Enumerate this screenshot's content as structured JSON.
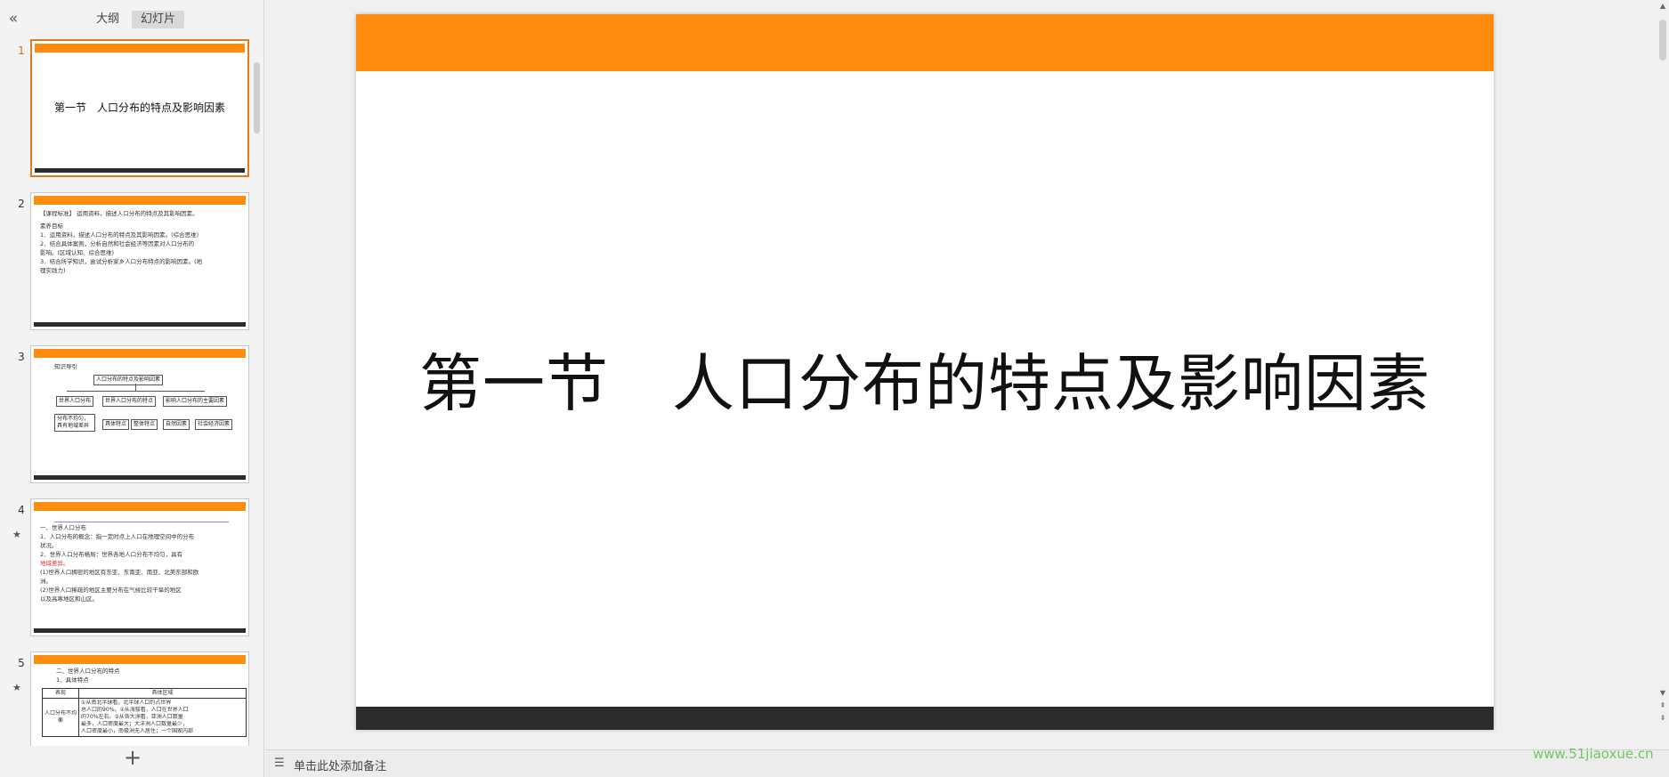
{
  "sidebar": {
    "collapse_icon": "«",
    "tabs": [
      "大纲",
      "幻灯片"
    ],
    "active_tab": "幻灯片",
    "add_icon": "+",
    "slides": [
      {
        "number": "1",
        "title": "第一节　人口分布的特点及影响因素"
      },
      {
        "number": "2",
        "lines": [
          "【课程标准】 运用资料，描述人口分布的特点及其影响因素。",
          "素养目标",
          "1．运用资料，描述人口分布的特点及其影响因素。(综合思维)",
          "2．结合具体案例，分析自然和社会经济等因素对人口分布的",
          "影响。(区域认知、综合思维)",
          "3．结合所学知识，尝试分析家乡人口分布特点的影响因素。(地",
          "理实践力)"
        ]
      },
      {
        "number": "3",
        "heading": "知识导引",
        "root": "人口分布的特点及影响因素",
        "level1": [
          "世界人口分布",
          "世界人口分布的特点",
          "影响人口分布的主要因素"
        ],
        "level2": [
          "分布不均匀，具有地域差异",
          "具体特点",
          "整体特点",
          "自然因素",
          "社会经济因素"
        ]
      },
      {
        "number": "4",
        "star": "★",
        "lines": [
          "一、世界人口分布",
          "1．人口分布的概念：指一定时点上人口在地理空间中的分布",
          "状况。",
          "2．世界人口分布格局：世界各地人口分布不均匀，具有",
          "地域差异。",
          "(1)世界人口稠密的地区有东亚、东南亚、南亚、北美东部和欧",
          "洲。",
          "(2)世界人口稀疏的地区主要分布在气候比较干旱的地区",
          "以及高寒地区和山区。"
        ]
      },
      {
        "number": "5",
        "star": "★",
        "lines": [
          "二、世界人口分布的特点",
          "1．具体特点"
        ],
        "table_header": [
          "表现",
          "具体区域"
        ],
        "table_row_label": "人口分布不均衡",
        "table_row_lines": [
          "①从南北半球看，北半球人口约占世界",
          "总人口的90%。②从海拔看，人口在世界人口",
          "的70%左右。③从各大洲看，亚洲人口数量",
          "最多，人口密度最大；大洋洲人口数量最少，",
          "人口密度最小，南极洲无人居住；一个国家内部"
        ]
      }
    ]
  },
  "slide": {
    "title": "第一节　人口分布的特点及影响因素",
    "accent_color": "#ff8c0f",
    "footer_color": "#2b2b2b"
  },
  "notes": {
    "icon": "☰",
    "placeholder": "单击此处添加备注"
  },
  "watermark": "www.51jiaoxue.cn"
}
